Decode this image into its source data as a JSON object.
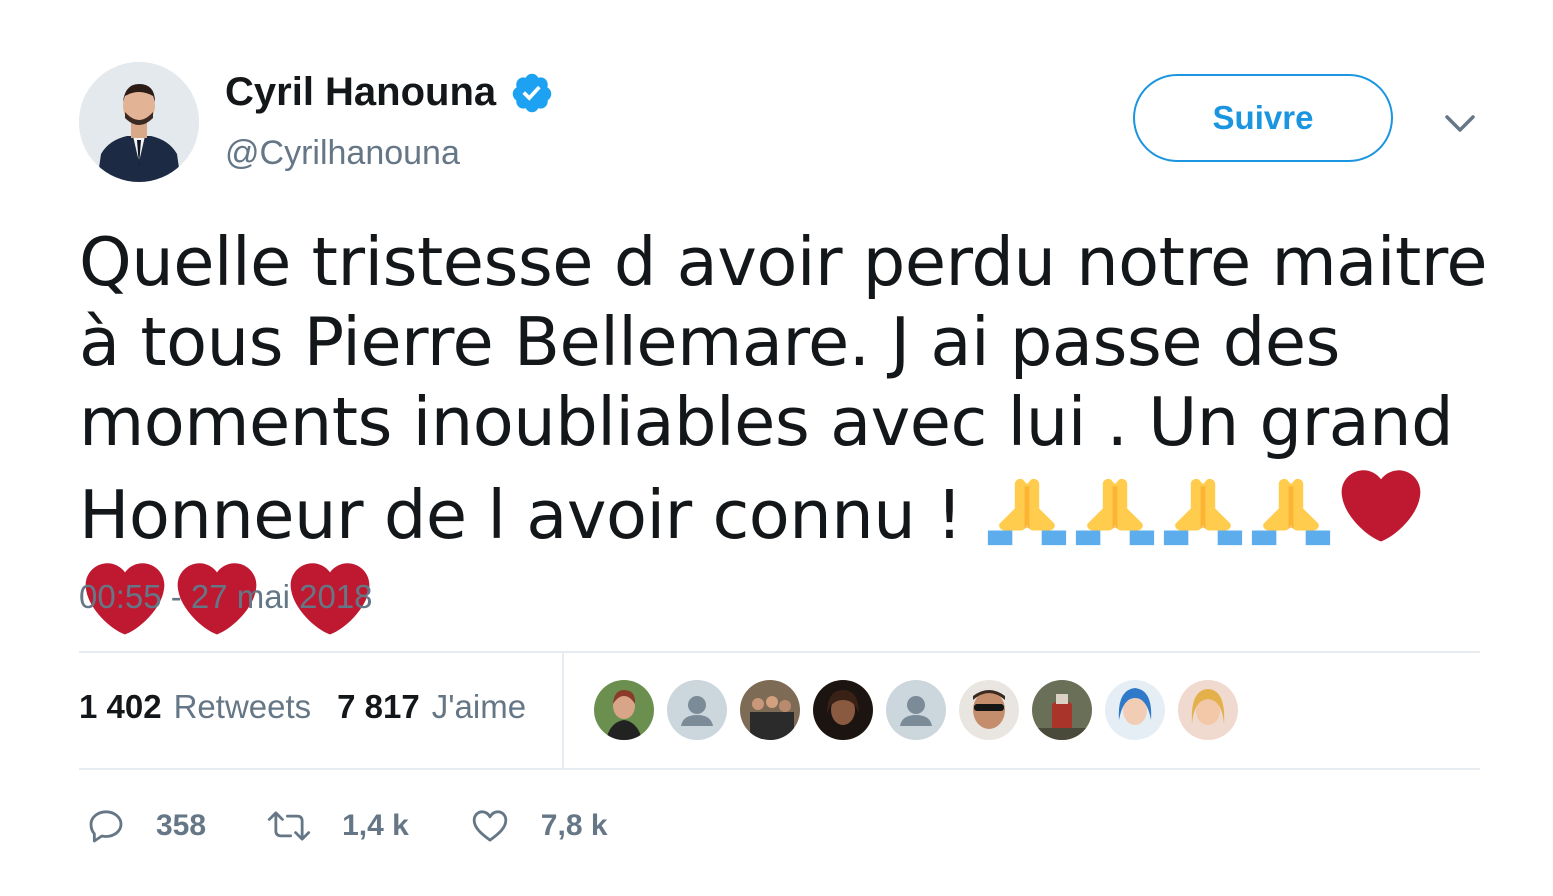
{
  "user": {
    "name": "Cyril Hanouna",
    "handle": "@Cyrilhanouna",
    "verified": true
  },
  "follow_button": {
    "label": "Suivre"
  },
  "tweet": {
    "text": "Quelle tristesse d avoir perdu notre maitre à tous Pierre Bellemare. J ai passe des moments inoubliables avec lui . Un grand Honneur de l avoir connu !",
    "emojis": [
      "folded-hands",
      "folded-hands",
      "folded-hands",
      "folded-hands",
      "red-heart",
      "red-heart",
      "red-heart",
      "red-heart"
    ],
    "timestamp": "00:55 - 27 mai 2018"
  },
  "stats": {
    "retweets_count": "1 402",
    "retweets_label": "Retweets",
    "likes_count": "7 817",
    "likes_label": "J'aime"
  },
  "likers": [
    {
      "kind": "photo"
    },
    {
      "kind": "default"
    },
    {
      "kind": "photo"
    },
    {
      "kind": "photo"
    },
    {
      "kind": "default"
    },
    {
      "kind": "photo"
    },
    {
      "kind": "photo"
    },
    {
      "kind": "photo"
    },
    {
      "kind": "photo"
    }
  ],
  "actions": {
    "reply_count": "358",
    "retweet_count": "1,4 k",
    "like_count": "7,8 k"
  },
  "colors": {
    "accent": "#1b95e0",
    "muted": "#657786",
    "heart": "#be1931",
    "hands": "#ffcc4d",
    "sleeves": "#5dadec"
  }
}
